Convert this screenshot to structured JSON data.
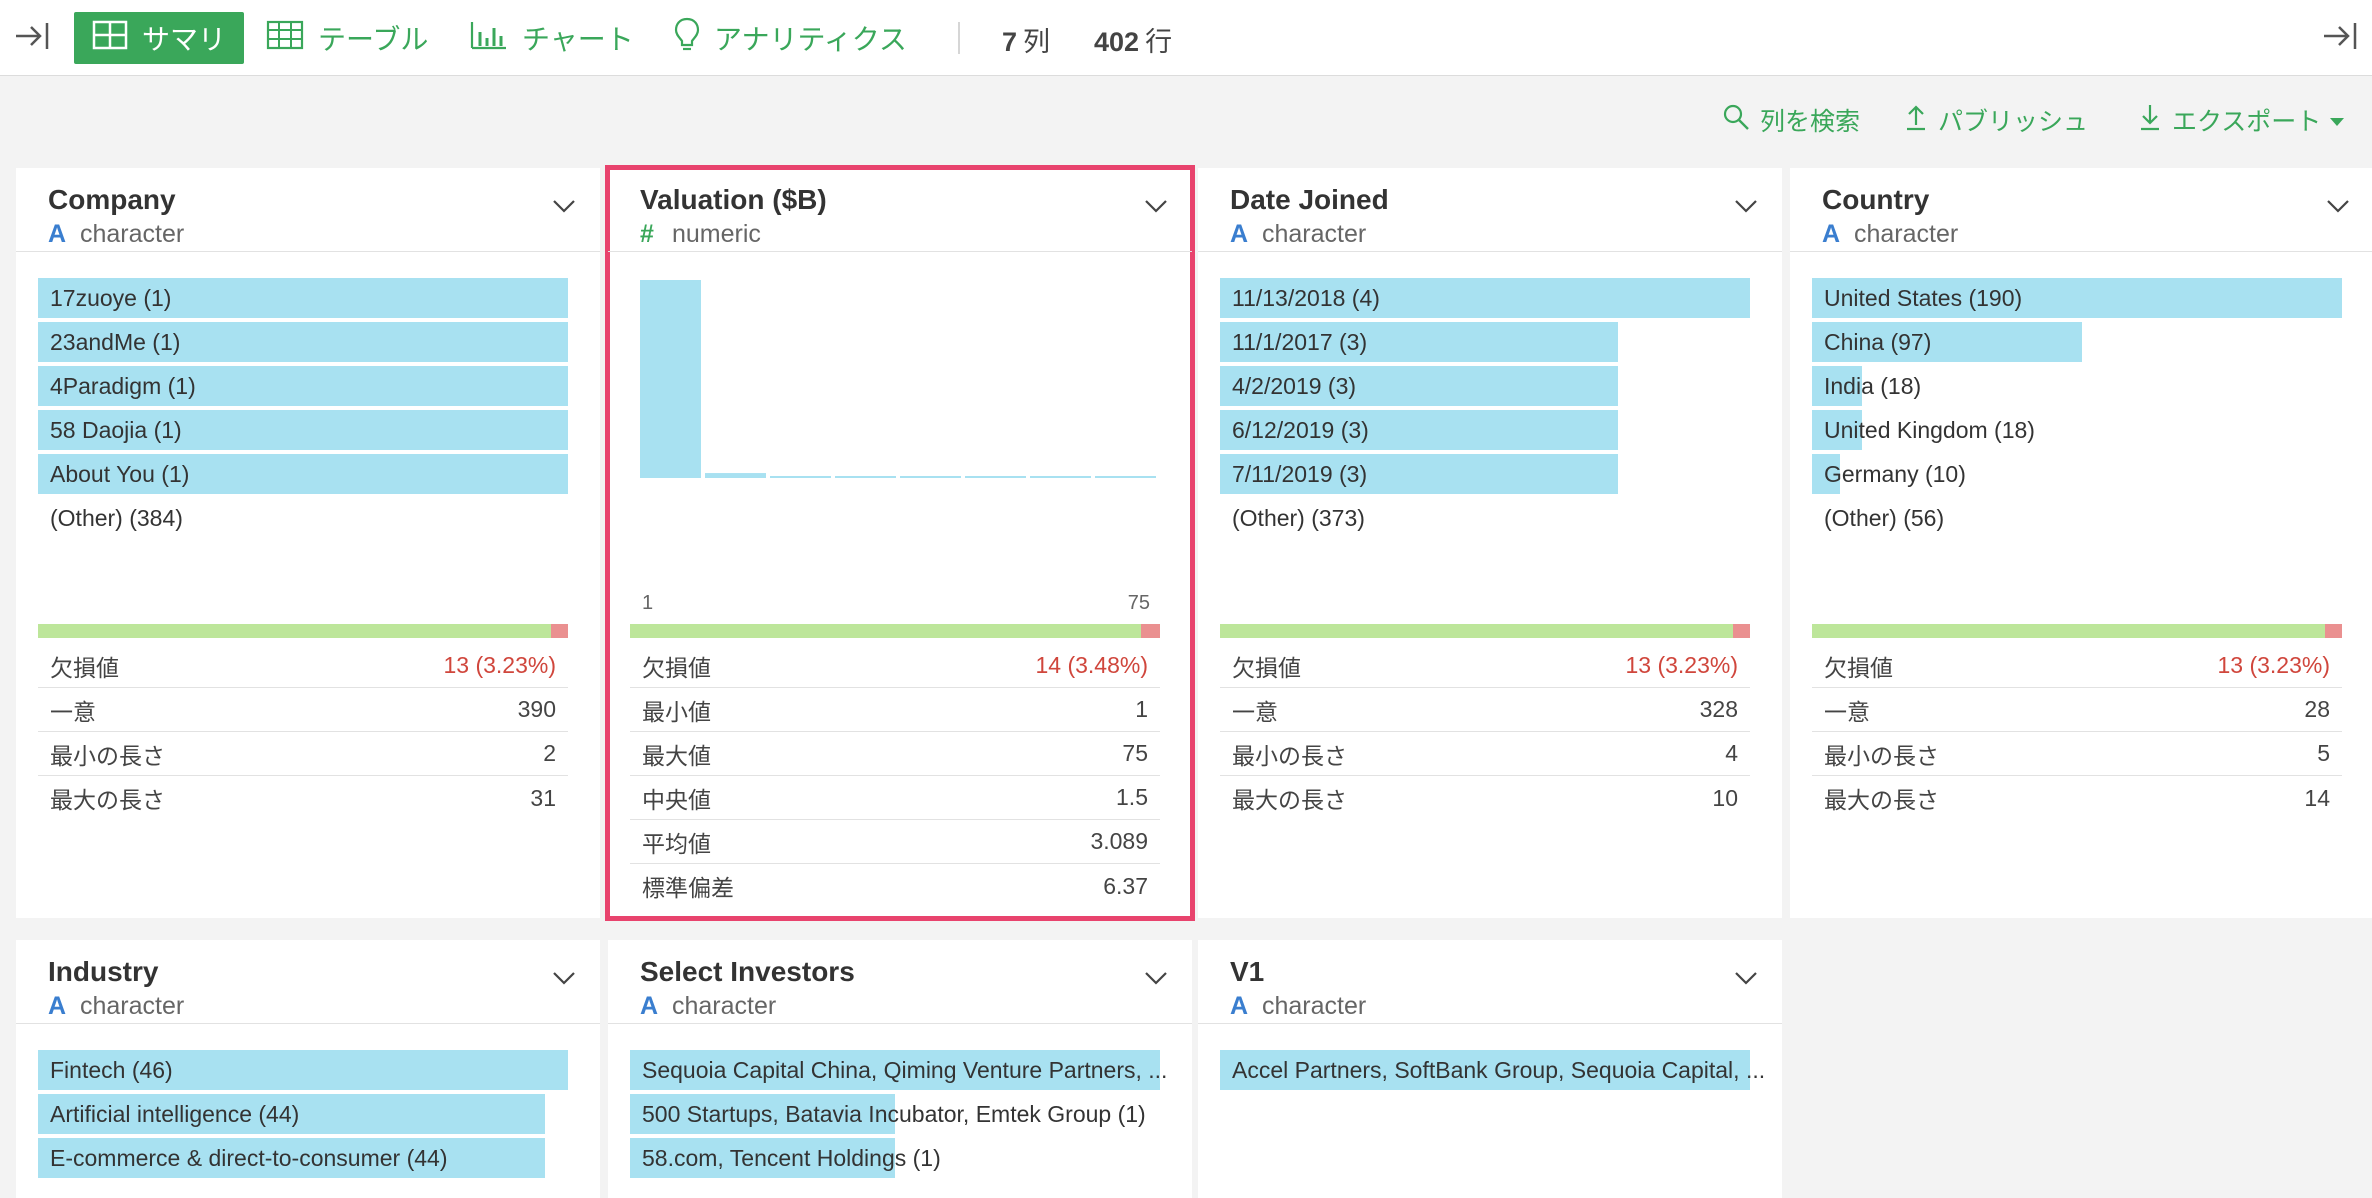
{
  "toolbar": {
    "tabs": [
      {
        "label": "サマリ",
        "icon": "grid-icon"
      },
      {
        "label": "テーブル",
        "icon": "table-icon"
      },
      {
        "label": "チャート",
        "icon": "bar-chart-icon"
      },
      {
        "label": "アナリティクス",
        "icon": "lightbulb-icon"
      }
    ],
    "columns_count": "7",
    "columns_unit": "列",
    "rows_count": "402",
    "rows_unit": "行"
  },
  "actions": {
    "search": "列を検索",
    "publish": "パブリッシュ",
    "export": "エクスポート"
  },
  "colors": {
    "accent": "#3aa75a",
    "bar": "#a8e1f1",
    "selected_border": "#e8436d",
    "missing": "#d0463c"
  },
  "cards": [
    {
      "title": "Company",
      "type": "character",
      "type_glyph": "A",
      "bars": [
        {
          "label": "17zuoye (1)",
          "fraction": 1.0
        },
        {
          "label": "23andMe (1)",
          "fraction": 1.0
        },
        {
          "label": "4Paradigm (1)",
          "fraction": 1.0
        },
        {
          "label": "58 Daojia (1)",
          "fraction": 1.0
        },
        {
          "label": "About You (1)",
          "fraction": 1.0
        },
        {
          "label": "(Other) (384)",
          "fraction": 0
        }
      ],
      "missing_fraction": 0.032,
      "stats": [
        {
          "label": "欠損値",
          "value": "13 (3.23%)",
          "red": true
        },
        {
          "label": "一意",
          "value": "390"
        },
        {
          "label": "最小の長さ",
          "value": "2"
        },
        {
          "label": "最大の長さ",
          "value": "31"
        }
      ]
    },
    {
      "title": "Valuation ($B)",
      "type": "numeric",
      "type_glyph": "#",
      "histogram": {
        "min_label": "1",
        "max_label": "75",
        "values": [
          1.0,
          0.025,
          0.006,
          0.006,
          0.006,
          0.006,
          0.006,
          0.006
        ]
      },
      "missing_fraction": 0.035,
      "stats": [
        {
          "label": "欠損値",
          "value": "14 (3.48%)",
          "red": true
        },
        {
          "label": "最小値",
          "value": "1"
        },
        {
          "label": "最大値",
          "value": "75"
        },
        {
          "label": "中央値",
          "value": "1.5"
        },
        {
          "label": "平均値",
          "value": "3.089"
        },
        {
          "label": "標準偏差",
          "value": "6.37"
        }
      ]
    },
    {
      "title": "Date Joined",
      "type": "character",
      "type_glyph": "A",
      "bars": [
        {
          "label": "11/13/2018 (4)",
          "fraction": 1.0
        },
        {
          "label": "11/1/2017 (3)",
          "fraction": 0.75
        },
        {
          "label": "4/2/2019 (3)",
          "fraction": 0.75
        },
        {
          "label": "6/12/2019 (3)",
          "fraction": 0.75
        },
        {
          "label": "7/11/2019 (3)",
          "fraction": 0.75
        },
        {
          "label": "(Other) (373)",
          "fraction": 0
        }
      ],
      "missing_fraction": 0.032,
      "stats": [
        {
          "label": "欠損値",
          "value": "13 (3.23%)",
          "red": true
        },
        {
          "label": "一意",
          "value": "328"
        },
        {
          "label": "最小の長さ",
          "value": "4"
        },
        {
          "label": "最大の長さ",
          "value": "10"
        }
      ]
    },
    {
      "title": "Country",
      "type": "character",
      "type_glyph": "A",
      "bars": [
        {
          "label": "United States (190)",
          "fraction": 1.0
        },
        {
          "label": "China (97)",
          "fraction": 0.51
        },
        {
          "label": "India (18)",
          "fraction": 0.095
        },
        {
          "label": "United Kingdom (18)",
          "fraction": 0.095
        },
        {
          "label": "Germany (10)",
          "fraction": 0.053
        },
        {
          "label": "(Other) (56)",
          "fraction": 0
        }
      ],
      "missing_fraction": 0.032,
      "stats": [
        {
          "label": "欠損値",
          "value": "13 (3.23%)",
          "red": true
        },
        {
          "label": "一意",
          "value": "28"
        },
        {
          "label": "最小の長さ",
          "value": "5"
        },
        {
          "label": "最大の長さ",
          "value": "14"
        }
      ]
    },
    {
      "title": "Industry",
      "type": "character",
      "type_glyph": "A",
      "bars": [
        {
          "label": "Fintech (46)",
          "fraction": 1.0
        },
        {
          "label": "Artificial intelligence (44)",
          "fraction": 0.957
        },
        {
          "label": "E-commerce & direct-to-consumer (44)",
          "fraction": 0.957
        }
      ]
    },
    {
      "title": "Select Investors",
      "type": "character",
      "type_glyph": "A",
      "bars": [
        {
          "label": "Sequoia Capital China, Qiming Venture Partners, ...",
          "fraction": 1.0
        },
        {
          "label": "500 Startups, Batavia Incubator, Emtek Group (1)",
          "fraction": 0.5
        },
        {
          "label": "58.com, Tencent Holdings (1)",
          "fraction": 0.5
        }
      ]
    },
    {
      "title": "V1",
      "type": "character",
      "type_glyph": "A",
      "bars": [
        {
          "label": "Accel Partners, SoftBank Group, Sequoia Capital, ...",
          "fraction": 1.0
        }
      ]
    }
  ]
}
